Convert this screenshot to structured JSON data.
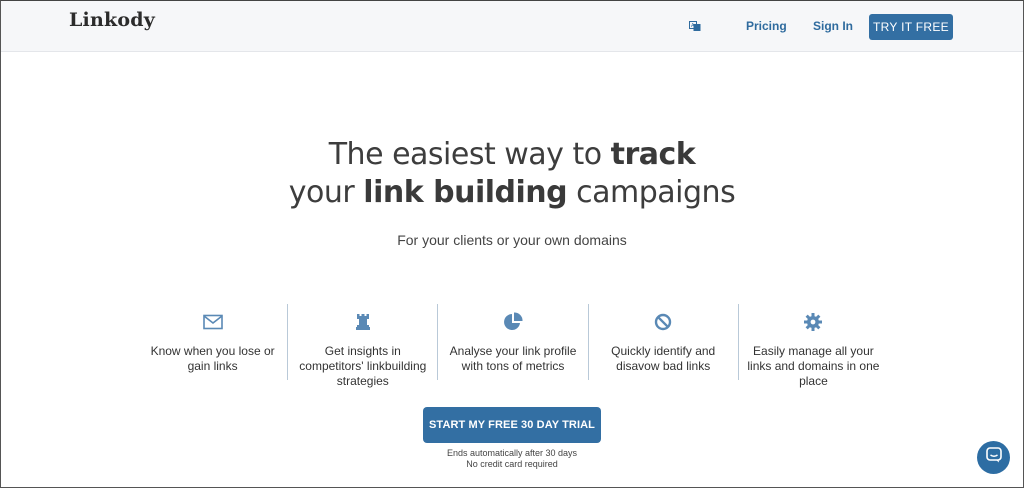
{
  "header": {
    "logo": "Linkody",
    "language_icon": "translate-icon",
    "nav": {
      "pricing": "Pricing",
      "sign_in": "Sign In"
    },
    "try_button": "TRY IT FREE"
  },
  "hero": {
    "line1_regular": "The easiest way to ",
    "line1_bold": "track",
    "line2_regular_a": "your ",
    "line2_bold": "link building",
    "line2_regular_b": " campaigns",
    "subtitle": "For your clients or your own domains"
  },
  "features": [
    {
      "icon": "envelope-icon",
      "text": "Know when you lose or gain links"
    },
    {
      "icon": "rook-icon",
      "text": "Get insights in competitors' linkbuilding strategies"
    },
    {
      "icon": "pie-chart-icon",
      "text": "Analyse your link profile with tons of metrics"
    },
    {
      "icon": "ban-icon",
      "text": "Quickly identify and disavow bad links"
    },
    {
      "icon": "gear-icon",
      "text": "Easily manage all your links and domains in one place"
    }
  ],
  "cta": {
    "label": "START MY FREE 30 DAY TRIAL",
    "note1": "Ends automatically after 30 days",
    "note2": "No credit card required"
  },
  "chat": {
    "icon": "chat-icon"
  },
  "colors": {
    "brand": "#336fa3",
    "link": "#2f6b9e",
    "icon": "#5a89b5"
  }
}
